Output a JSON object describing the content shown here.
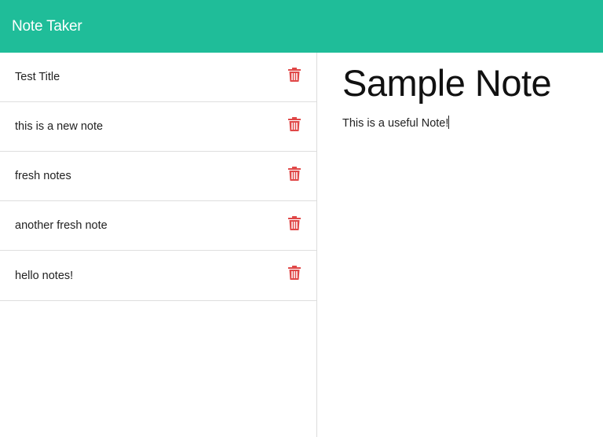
{
  "app": {
    "title": "Note Taker"
  },
  "notes": [
    {
      "title": "Test Title",
      "delete_icon": "trash-icon"
    },
    {
      "title": "this is a new note",
      "delete_icon": "trash-icon"
    },
    {
      "title": "fresh notes",
      "delete_icon": "trash-icon"
    },
    {
      "title": "another fresh note",
      "delete_icon": "trash-icon"
    },
    {
      "title": "hello notes!",
      "delete_icon": "trash-icon"
    }
  ],
  "active_note": {
    "title": "Sample Note",
    "text": "This is a useful Note!"
  },
  "colors": {
    "navbar": "#1fbd99",
    "trash": "#e04848"
  }
}
